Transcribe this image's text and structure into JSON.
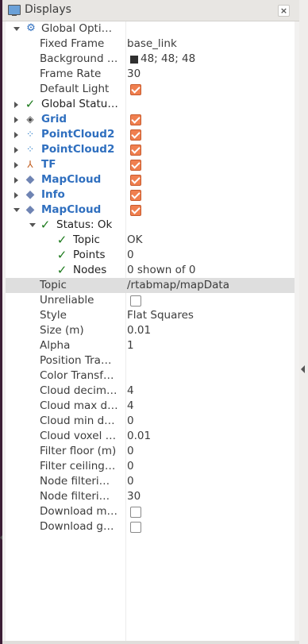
{
  "panel": {
    "title": "Displays",
    "close_glyph": "×"
  },
  "tree": {
    "global_options": {
      "label": "Global Opti…",
      "fixed_frame_label": "Fixed Frame",
      "fixed_frame_value": "base_link",
      "background_label": "Background …",
      "background_value": "48; 48; 48",
      "background_color": "#303030",
      "frame_rate_label": "Frame Rate",
      "frame_rate_value": "30",
      "default_light_label": "Default Light",
      "default_light_checked": true
    },
    "global_status": {
      "label": "Global Statu…"
    },
    "displays": [
      {
        "label": "Grid",
        "icon": "grid-icon",
        "checked": true
      },
      {
        "label": "PointCloud2",
        "icon": "pointcloud-icon",
        "checked": true
      },
      {
        "label": "PointCloud2",
        "icon": "pointcloud-icon",
        "checked": true
      },
      {
        "label": "TF",
        "icon": "tf-icon",
        "checked": true
      },
      {
        "label": "MapCloud",
        "icon": "mapcloud-icon",
        "checked": true
      },
      {
        "label": "Info",
        "icon": "info-icon",
        "checked": true
      },
      {
        "label": "MapCloud",
        "icon": "mapcloud-icon",
        "checked": true
      }
    ],
    "status": {
      "label": "Status: Ok",
      "items": [
        {
          "label": "Topic",
          "value": "OK"
        },
        {
          "label": "Points",
          "value": "0"
        },
        {
          "label": "Nodes",
          "value": "0 shown of 0"
        }
      ]
    },
    "properties": [
      {
        "label": "Topic",
        "value": "/rtabmap/mapData"
      },
      {
        "label": "Unreliable",
        "checkbox": true,
        "checked": false
      },
      {
        "label": "Style",
        "value": "Flat Squares"
      },
      {
        "label": "Size (m)",
        "value": "0.01"
      },
      {
        "label": "Alpha",
        "value": "1"
      },
      {
        "label": "Position Tra…",
        "value": ""
      },
      {
        "label": "Color Transf…",
        "value": ""
      },
      {
        "label": "Cloud decim…",
        "value": "4"
      },
      {
        "label": "Cloud max d…",
        "value": "4"
      },
      {
        "label": "Cloud min d…",
        "value": "0"
      },
      {
        "label": "Cloud voxel …",
        "value": "0.01"
      },
      {
        "label": "Filter floor (m)",
        "value": "0"
      },
      {
        "label": "Filter ceiling…",
        "value": "0"
      },
      {
        "label": "Node filteri…",
        "value": "0"
      },
      {
        "label": "Node filteri…",
        "value": "30"
      },
      {
        "label": "Download m…",
        "checkbox": true,
        "checked": false
      },
      {
        "label": "Download g…",
        "checkbox": true,
        "checked": false
      }
    ]
  },
  "colors": {
    "display_label_blue": "#2f6fbf",
    "checkbox_checked": "#f07f4f",
    "check_green": "#1c7a1c",
    "selected_row": "#dedede"
  }
}
